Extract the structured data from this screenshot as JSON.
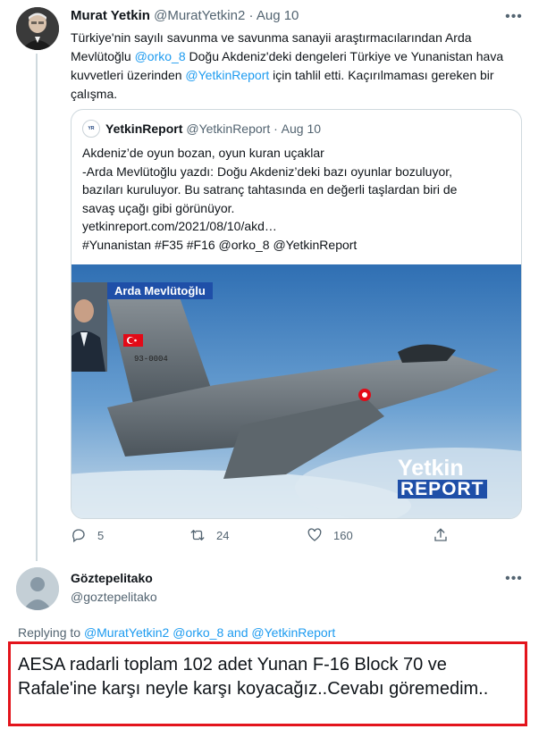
{
  "tweet": {
    "author_name": "Murat Yetkin",
    "author_handle": "@MuratYetkin2",
    "separator": "·",
    "date": "Aug 10",
    "text_part1": "Türkiye'nin sayılı savunma ve savunma sanayii araştırmacılarından Arda Mevlütoğlu ",
    "mention1": "@orko_8",
    "text_part2": " Doğu Akdeniz'deki dengeleri Türkiye ve Yunanistan hava kuvvetleri üzerinden ",
    "mention2": "@YetkinReport",
    "text_part3": " için tahlil etti. Kaçırılmaması gereken bir çalışma.",
    "quote": {
      "author_name": "YetkinReport",
      "author_handle": "@YetkinReport",
      "separator": "·",
      "date": "Aug 10",
      "lines": [
        "Akdeniz’de oyun bozan, oyun kuran uçaklar",
        "-Arda Mevlütoğlu yazdı: Doğu Akdeniz’deki bazı oyunlar bozuluyor,",
        "bazıları kuruluyor. Bu satranç tahtasında en değerli taşlardan biri de",
        "savaş uçağı gibi görünüyor.",
        "yetkinreport.com/2021/08/10/akd…",
        "#Yunanistan #F35 #F16 @orko_8 @YetkinReport"
      ],
      "image": {
        "caption_name": "Arda Mevlütoğlu",
        "tail_number": "93-0004",
        "brand_line1": "Yetkin",
        "brand_line2": "REPORT"
      }
    },
    "actions": {
      "reply_count": "5",
      "retweet_count": "24",
      "like_count": "160"
    }
  },
  "reply": {
    "author_name": "Göztepelitako",
    "author_handle": "@goztepelitako",
    "replying_prefix": "Replying to ",
    "replying_mentions": "@MuratYetkin2 @orko_8 and @YetkinReport",
    "text": "AESA radarli toplam 102 adet Yunan F-16 Block 70 ve Rafale'ine karşı neyle karşı koyacağız..Cevabı göremedim.."
  },
  "icons": [
    "avatar",
    "more-icon",
    "reply-icon",
    "retweet-icon",
    "like-icon",
    "share-icon",
    "turkish-flag-icon"
  ],
  "colors": {
    "link": "#1d9bf0",
    "muted": "#536471",
    "highlight_border": "#e3141c",
    "brand_blue": "#1f4fa8"
  }
}
